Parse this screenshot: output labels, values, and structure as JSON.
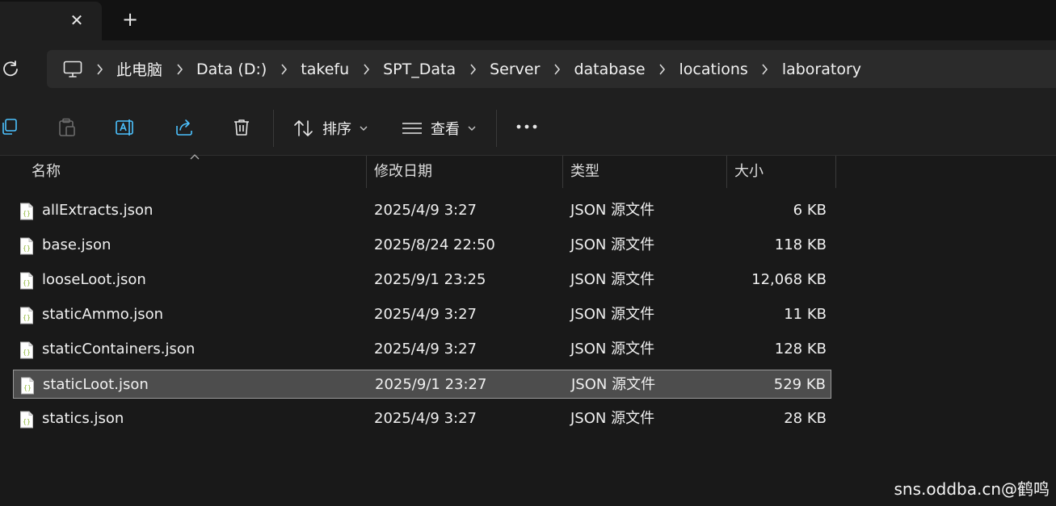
{
  "tab": {
    "close_glyph": "✕",
    "new_glyph": "+"
  },
  "address": {
    "crumbs": [
      "此电脑",
      "Data (D:)",
      "takefu",
      "SPT_Data",
      "Server",
      "database",
      "locations",
      "laboratory"
    ]
  },
  "toolbar": {
    "sort_label": "排序",
    "view_label": "查看"
  },
  "columns": {
    "name": "名称",
    "date": "修改日期",
    "type": "类型",
    "size": "大小"
  },
  "files": [
    {
      "name": "allExtracts.json",
      "date": "2025/4/9 3:27",
      "type": "JSON 源文件",
      "size": "6 KB",
      "selected": false
    },
    {
      "name": "base.json",
      "date": "2025/8/24 22:50",
      "type": "JSON 源文件",
      "size": "118 KB",
      "selected": false
    },
    {
      "name": "looseLoot.json",
      "date": "2025/9/1 23:25",
      "type": "JSON 源文件",
      "size": "12,068 KB",
      "selected": false
    },
    {
      "name": "staticAmmo.json",
      "date": "2025/4/9 3:27",
      "type": "JSON 源文件",
      "size": "11 KB",
      "selected": false
    },
    {
      "name": "staticContainers.json",
      "date": "2025/4/9 3:27",
      "type": "JSON 源文件",
      "size": "128 KB",
      "selected": false
    },
    {
      "name": "staticLoot.json",
      "date": "2025/9/1 23:27",
      "type": "JSON 源文件",
      "size": "529 KB",
      "selected": true
    },
    {
      "name": "statics.json",
      "date": "2025/4/9 3:27",
      "type": "JSON 源文件",
      "size": "28 KB",
      "selected": false
    }
  ],
  "watermark": "sns.oddba.cn@鹤鸣",
  "colors": {
    "background": "#191919",
    "selected_row": "#4d4d4d",
    "icon_accent": "#8fb838"
  }
}
